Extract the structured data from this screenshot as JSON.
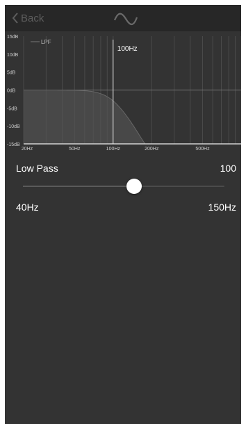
{
  "nav": {
    "back_label": "Back",
    "center_icon": "sine-wave-icon"
  },
  "graph": {
    "legend": "LPF",
    "db_labels": [
      "15dB",
      "10dB",
      "5dB",
      "0dB",
      "-5dB",
      "-10dB",
      "-15dB"
    ],
    "freq_labels": [
      "20Hz",
      "50Hz",
      "100Hz",
      "200Hz",
      "500Hz"
    ],
    "cutoff_label": "100Hz",
    "cutoff_hz": 100,
    "db_range": [
      -15,
      15
    ],
    "freq_range_hz": [
      20,
      1000
    ]
  },
  "control": {
    "label": "Low Pass",
    "value": "100",
    "min_label": "40Hz",
    "max_label": "150Hz",
    "slider_fraction": 0.55
  },
  "colors": {
    "accent": "#ffffff",
    "background": "#333333",
    "navbar": "#272727"
  }
}
